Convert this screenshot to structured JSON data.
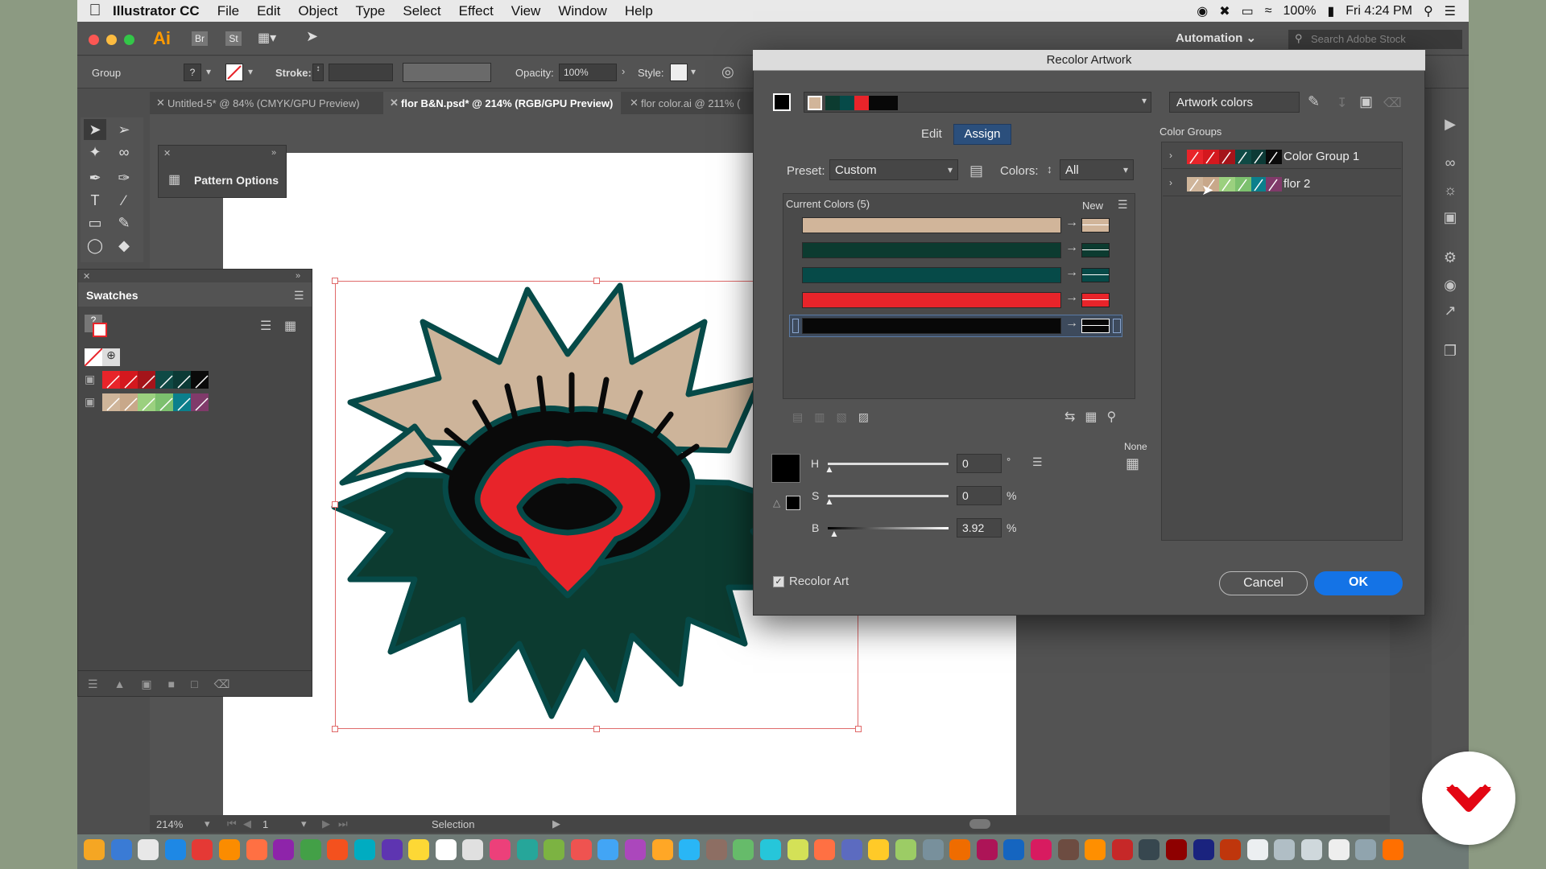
{
  "menubar": {
    "app_name": "Illustrator CC",
    "menus": [
      "File",
      "Edit",
      "Object",
      "Type",
      "Select",
      "Effect",
      "View",
      "Window",
      "Help"
    ],
    "battery": "100%",
    "clock": "Fri 4:24 PM"
  },
  "appbar": {
    "ai_badge": "Ai",
    "br_badge": "Br",
    "st_badge": "St",
    "workspace": "Automation",
    "search_placeholder": "Search Adobe Stock"
  },
  "control": {
    "selection_type": "Group",
    "stroke_label": "Stroke:",
    "opacity_label": "Opacity:",
    "opacity_value": "100%",
    "style_label": "Style:"
  },
  "doc_tabs": [
    {
      "label": "Untitled-5* @ 84% (CMYK/GPU Preview)"
    },
    {
      "label": "flor B&N.psd* @ 214% (RGB/GPU Preview)"
    },
    {
      "label": "flor color.ai @ 211% ("
    }
  ],
  "pattern_options": {
    "label": "Pattern Options"
  },
  "swatches": {
    "title": "Swatches",
    "row1": [
      "#e8242a",
      "#d4181e",
      "#a4141a",
      "#0f4a45",
      "#0c3a36",
      "#0a0a0a"
    ],
    "row2": [
      "#cfb59a",
      "#c8a88a",
      "#9bd07f",
      "#7cc06e",
      "#0b7f8c",
      "#803a6a"
    ]
  },
  "status": {
    "zoom": "214%",
    "page": "1",
    "tool": "Selection"
  },
  "dialog": {
    "title": "Recolor Artwork",
    "artwork_colors": "Artwork colors",
    "tab_edit": "Edit",
    "tab_assign": "Assign",
    "preset_label": "Preset:",
    "preset_value": "Custom",
    "colors_label": "Colors:",
    "colors_value": "All",
    "current_colors_label": "Current Colors (5)",
    "new_label": "New",
    "color_groups_label": "Color Groups",
    "color_groups": [
      {
        "name": "Color Group 1"
      },
      {
        "name": "flor 2"
      }
    ],
    "current_colors": [
      "#d1b59a",
      "#0c3b30",
      "#064a48",
      "#e8242a",
      "#080808"
    ],
    "h_label": "H",
    "h_value": "0",
    "h_unit": "°",
    "s_label": "S",
    "s_value": "0",
    "s_unit": "%",
    "b_label": "B",
    "b_value": "3.92",
    "b_unit": "%",
    "none_label": "None",
    "recolor_art_label": "Recolor Art",
    "cancel_label": "Cancel",
    "ok_label": "OK"
  },
  "colors": {
    "accent": "#1473e6",
    "flower_tan": "#cdb49a",
    "flower_dark": "#0c3b30",
    "flower_teal_outline": "#064a48",
    "flower_red": "#e8242a"
  }
}
